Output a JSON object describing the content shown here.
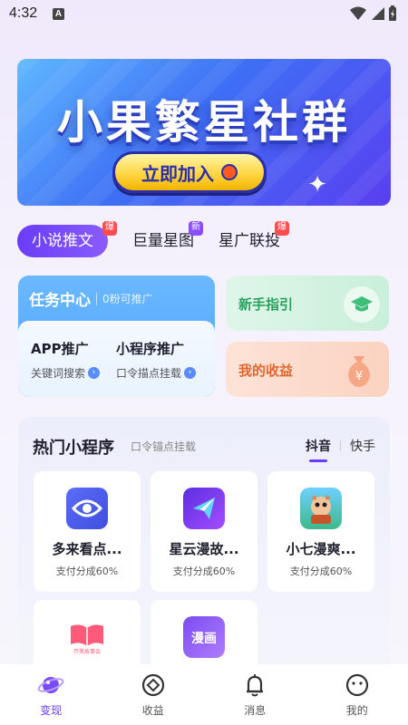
{
  "status_bar": {
    "time": "4:32",
    "notification_letter": "A"
  },
  "banner": {
    "title": "小果繁星社群",
    "button_label": "立即加入"
  },
  "tabs": [
    {
      "label": "小说推文",
      "badge": "爆",
      "active": true
    },
    {
      "label": "巨量星图",
      "badge": "新",
      "active": false
    },
    {
      "label": "星广联投",
      "badge": "爆",
      "active": false
    }
  ],
  "task_center": {
    "title": "任务中心",
    "subtitle": "0粉可推广",
    "items": [
      {
        "title": "APP推广",
        "desc": "关键词搜索"
      },
      {
        "title": "小程序推广",
        "desc": "口令描点挂载"
      }
    ]
  },
  "guide_card": {
    "label": "新手指引"
  },
  "income_card": {
    "label": "我的收益",
    "icon_symbol": "¥"
  },
  "hot_programs": {
    "title": "热门小程序",
    "subtitle": "口令锚点挂载",
    "tabs": [
      {
        "label": "抖音",
        "active": true
      },
      {
        "label": "快手",
        "active": false
      }
    ],
    "items": [
      {
        "name": "多来看点...",
        "share": "支付分成60%",
        "icon": "eye-icon",
        "color": "#4a5cf0"
      },
      {
        "name": "星云漫故...",
        "share": "支付分成60%",
        "icon": "star-plane-icon",
        "color": "#7a3cf5"
      },
      {
        "name": "小七漫爽...",
        "share": "支付分成60%",
        "icon": "mascot-icon",
        "color": "#3cb98a"
      },
      {
        "name": "",
        "share": "",
        "icon": "book-icon",
        "color": "#ff5a7a",
        "icon_caption": "芥茉故事会"
      },
      {
        "name": "",
        "share": "",
        "icon": "manga-icon",
        "color": "#8a5cf5",
        "icon_caption": "漫画"
      }
    ]
  },
  "bottom_nav": [
    {
      "label": "变现",
      "icon": "planet-icon",
      "active": true
    },
    {
      "label": "收益",
      "icon": "coin-icon",
      "active": false
    },
    {
      "label": "消息",
      "icon": "bell-icon",
      "active": false
    },
    {
      "label": "我的",
      "icon": "face-icon",
      "active": false
    }
  ],
  "colors": {
    "accent": "#6a3cf5",
    "task_blue": "#4fa3ff",
    "guide_green": "#2aa05f",
    "income_orange": "#e0662f"
  }
}
